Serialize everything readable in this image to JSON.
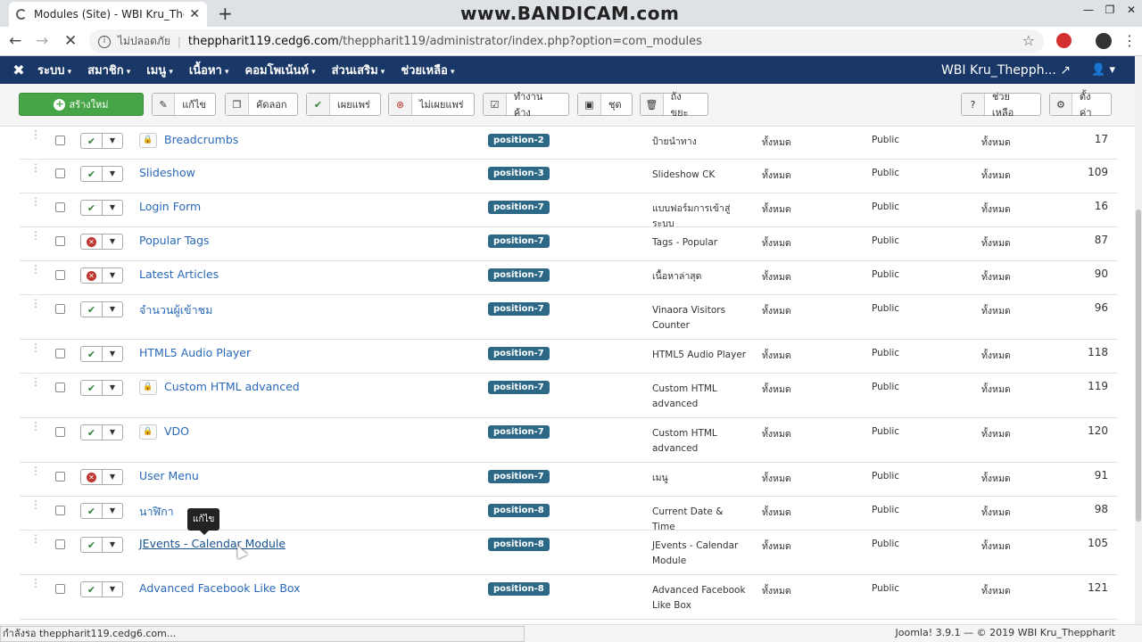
{
  "browser": {
    "tab_title": "Modules (Site) - WBI Kru_Thepph",
    "tab_close": "✕",
    "new_tab": "+",
    "watermark": "www.BANDICAM.com",
    "window_buttons": [
      "—",
      "❐",
      "✕"
    ],
    "security_label": "ไม่ปลอดภัย",
    "url_host": "theppharit119.cedg6.com",
    "url_path": "/theppharit119/administrator/index.php?option=com_modules",
    "back": "←",
    "forward": "→",
    "stop": "✕",
    "star": "☆"
  },
  "topnav": {
    "logo": "✖",
    "items": [
      "ระบบ",
      "สมาชิก",
      "เมนู",
      "เนื้อหา",
      "คอมโพเน้นท์",
      "ส่วนเสริม",
      "ช่วยเหลือ"
    ],
    "site_name": "WBI Kru_Thepph... ↗",
    "user": "👤 ▾"
  },
  "toolbar": {
    "new": "สร้างใหม่",
    "edit": "แก้ไข",
    "copy": "คัดลอก",
    "publish": "เผยแพร่",
    "unpublish": "ไม่เผยแพร่",
    "checkin": "ทำงานค้าง",
    "trash": "ถังขยะ",
    "batch": "ชุด",
    "help": "ช่วยเหลือ",
    "options": "ตั้งค่า"
  },
  "rows": [
    {
      "title": "Breadcrumbs",
      "locked": true,
      "published": true,
      "position": "position-2",
      "type": [
        "ป้ายนำทาง"
      ],
      "pages": "ทั้งหมด",
      "access": "Public",
      "language": "ทั้งหมด",
      "id": "17"
    },
    {
      "title": "Slideshow",
      "locked": false,
      "published": true,
      "position": "position-3",
      "type": [
        "Slideshow CK"
      ],
      "pages": "ทั้งหมด",
      "access": "Public",
      "language": "ทั้งหมด",
      "id": "109"
    },
    {
      "title": "Login Form",
      "locked": false,
      "published": true,
      "position": "position-7",
      "type": [
        "แบบฟอร์มการเข้าสู่ระบบ"
      ],
      "pages": "ทั้งหมด",
      "access": "Public",
      "language": "ทั้งหมด",
      "id": "16"
    },
    {
      "title": "Popular Tags",
      "locked": false,
      "published": false,
      "position": "position-7",
      "type": [
        "Tags - Popular"
      ],
      "pages": "ทั้งหมด",
      "access": "Public",
      "language": "ทั้งหมด",
      "id": "87"
    },
    {
      "title": "Latest Articles",
      "locked": false,
      "published": false,
      "position": "position-7",
      "type": [
        "เนื้อหาล่าสุด"
      ],
      "pages": "ทั้งหมด",
      "access": "Public",
      "language": "ทั้งหมด",
      "id": "90"
    },
    {
      "title": "จำนวนผู้เข้าชม",
      "locked": false,
      "published": true,
      "position": "position-7",
      "type": [
        "Vinaora Visitors",
        "Counter"
      ],
      "pages": "ทั้งหมด",
      "access": "Public",
      "language": "ทั้งหมด",
      "id": "96"
    },
    {
      "title": "HTML5 Audio Player",
      "locked": false,
      "published": true,
      "position": "position-7",
      "type": [
        "HTML5 Audio Player"
      ],
      "pages": "ทั้งหมด",
      "access": "Public",
      "language": "ทั้งหมด",
      "id": "118"
    },
    {
      "title": "Custom HTML advanced",
      "locked": true,
      "published": true,
      "position": "position-7",
      "type": [
        "Custom HTML",
        "advanced"
      ],
      "pages": "ทั้งหมด",
      "access": "Public",
      "language": "ทั้งหมด",
      "id": "119"
    },
    {
      "title": "VDO",
      "locked": true,
      "published": true,
      "position": "position-7",
      "type": [
        "Custom HTML",
        "advanced"
      ],
      "pages": "ทั้งหมด",
      "access": "Public",
      "language": "ทั้งหมด",
      "id": "120"
    },
    {
      "title": "User Menu",
      "locked": false,
      "published": false,
      "position": "position-7",
      "type": [
        "เมนู"
      ],
      "pages": "ทั้งหมด",
      "access": "Public",
      "language": "ทั้งหมด",
      "id": "91"
    },
    {
      "title": "นาฬิกา",
      "locked": false,
      "published": true,
      "position": "position-8",
      "type": [
        "Current Date & Time"
      ],
      "pages": "ทั้งหมด",
      "access": "Public",
      "language": "ทั้งหมด",
      "id": "98"
    },
    {
      "title": "JEvents - Calendar Module",
      "locked": false,
      "published": true,
      "position": "position-8",
      "type": [
        "JEvents - Calendar",
        "Module"
      ],
      "pages": "ทั้งหมด",
      "access": "Public",
      "language": "ทั้งหมด",
      "id": "105"
    },
    {
      "title": "Advanced Facebook Like Box",
      "locked": false,
      "published": true,
      "position": "position-8",
      "type": [
        "Advanced Facebook",
        "Like Box"
      ],
      "pages": "ทั้งหมด",
      "access": "Public",
      "language": "ทั้งหมด",
      "id": "121"
    }
  ],
  "tooltip": "แก้ไข",
  "status_loading": "กำลังรอ theppharit119.cedg6.com...",
  "footer": "Joomla! 3.9.1  —  © 2019 WBI Kru_Theppharit",
  "colors": {
    "nav": "#1a3867",
    "new_button": "#46a546",
    "position_badge": "#2d6987",
    "link": "#2a69b8",
    "published": "#378137",
    "unpublished": "#bd362f"
  }
}
